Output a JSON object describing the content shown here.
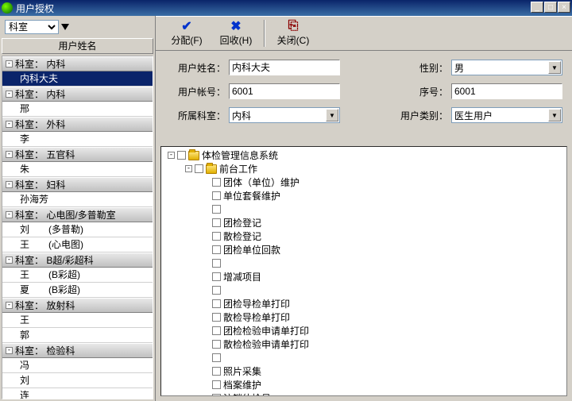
{
  "window": {
    "title": "用户授权"
  },
  "filter": {
    "label": "科室"
  },
  "columnHeader": "用户姓名",
  "deptTree": [
    {
      "type": "grp",
      "label": "科室： 内科"
    },
    {
      "type": "person",
      "label": "内科大夫",
      "selected": true
    },
    {
      "type": "grp",
      "label": "科室： 内科"
    },
    {
      "type": "person",
      "label": "邢"
    },
    {
      "type": "grp",
      "label": "科室： 外科"
    },
    {
      "type": "person",
      "label": "李"
    },
    {
      "type": "grp",
      "label": "科室： 五官科"
    },
    {
      "type": "person",
      "label": "朱"
    },
    {
      "type": "grp",
      "label": "科室： 妇科"
    },
    {
      "type": "person",
      "label": "孙海芳"
    },
    {
      "type": "grp",
      "label": "科室： 心电图/多普勒室"
    },
    {
      "type": "person",
      "label": "刘  (多普勒)"
    },
    {
      "type": "person",
      "label": "王  (心电图)"
    },
    {
      "type": "grp",
      "label": "科室： B超/彩超科"
    },
    {
      "type": "person",
      "label": "王  (B彩超)"
    },
    {
      "type": "person",
      "label": "夏  (B彩超)"
    },
    {
      "type": "grp",
      "label": "科室： 放射科"
    },
    {
      "type": "person",
      "label": "王"
    },
    {
      "type": "person",
      "label": "郭"
    },
    {
      "type": "grp",
      "label": "科室： 检验科"
    },
    {
      "type": "person",
      "label": "冯"
    },
    {
      "type": "person",
      "label": "刘"
    },
    {
      "type": "person",
      "label": "连"
    }
  ],
  "toolbar": {
    "assign": "分配(F)",
    "recycle": "回收(H)",
    "close": "关闭(C)"
  },
  "form": {
    "username_label": "用户姓名：",
    "username": "内科大夫",
    "gender_label": "性别：",
    "gender": "男",
    "account_label": "用户帐号：",
    "account": "6001",
    "seq_label": "序号：",
    "seq": "6001",
    "dept_label": "所属科室：",
    "dept": "内科",
    "usertype_label": "用户类别：",
    "usertype": "医生用户"
  },
  "permtree": [
    {
      "indent": 0,
      "pm": "-",
      "cb": true,
      "folder": true,
      "label": "体检管理信息系统"
    },
    {
      "indent": 1,
      "pm": "-",
      "cb": true,
      "folder": true,
      "label": "前台工作"
    },
    {
      "indent": 2,
      "pm": "",
      "cb": true,
      "folder": false,
      "label": "团体（单位）维护"
    },
    {
      "indent": 2,
      "pm": "",
      "cb": true,
      "folder": false,
      "label": "单位套餐维护"
    },
    {
      "indent": 2,
      "pm": "",
      "cb": true,
      "folder": false,
      "label": ""
    },
    {
      "indent": 2,
      "pm": "",
      "cb": true,
      "folder": false,
      "label": "团检登记"
    },
    {
      "indent": 2,
      "pm": "",
      "cb": true,
      "folder": false,
      "label": "散检登记"
    },
    {
      "indent": 2,
      "pm": "",
      "cb": true,
      "folder": false,
      "label": "团检单位回款"
    },
    {
      "indent": 2,
      "pm": "",
      "cb": true,
      "folder": false,
      "label": ""
    },
    {
      "indent": 2,
      "pm": "",
      "cb": true,
      "folder": false,
      "label": "增减项目"
    },
    {
      "indent": 2,
      "pm": "",
      "cb": true,
      "folder": false,
      "label": ""
    },
    {
      "indent": 2,
      "pm": "",
      "cb": true,
      "folder": false,
      "label": "团检导检单打印"
    },
    {
      "indent": 2,
      "pm": "",
      "cb": true,
      "folder": false,
      "label": "散检导检单打印"
    },
    {
      "indent": 2,
      "pm": "",
      "cb": true,
      "folder": false,
      "label": "团检检验申请单打印"
    },
    {
      "indent": 2,
      "pm": "",
      "cb": true,
      "folder": false,
      "label": "散检检验申请单打印"
    },
    {
      "indent": 2,
      "pm": "",
      "cb": true,
      "folder": false,
      "label": ""
    },
    {
      "indent": 2,
      "pm": "",
      "cb": true,
      "folder": false,
      "label": "照片采集"
    },
    {
      "indent": 2,
      "pm": "",
      "cb": true,
      "folder": false,
      "label": "档案维护"
    },
    {
      "indent": 2,
      "pm": "",
      "cb": true,
      "folder": false,
      "label": "注销体检号"
    }
  ]
}
